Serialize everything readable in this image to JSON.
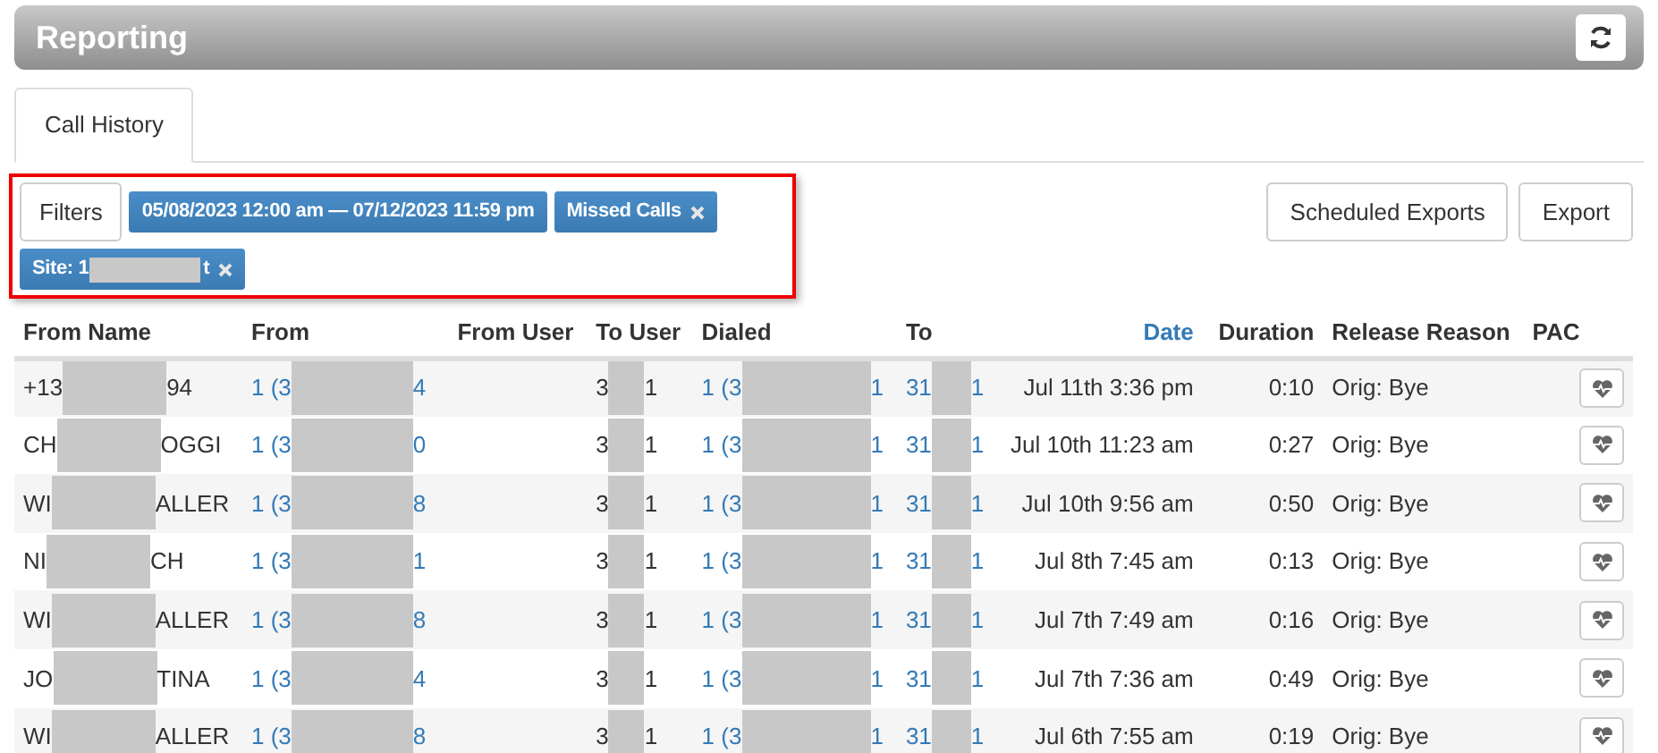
{
  "header": {
    "title": "Reporting"
  },
  "tabs": [
    {
      "label": "Call History",
      "selected": true
    }
  ],
  "filters": {
    "button": "Filters",
    "chips": [
      {
        "parts": [
          "05/08/2023 12:00 am — 07/12/2023 11:59 pm"
        ],
        "removable": false
      },
      {
        "parts": [
          "Missed Calls"
        ],
        "removable": true
      },
      {
        "parts": [
          "Site: 1",
          "t"
        ],
        "removable": true
      }
    ],
    "highlighted": true
  },
  "actions": [
    "Scheduled Exports",
    "Export"
  ],
  "table": {
    "columns": [
      {
        "label": "From Name",
        "sorted": false
      },
      {
        "label": "From",
        "sorted": false
      },
      {
        "label": "From User",
        "sorted": false
      },
      {
        "label": "To User",
        "sorted": false
      },
      {
        "label": "Dialed",
        "sorted": false
      },
      {
        "label": "To",
        "sorted": false
      },
      {
        "label": "Date",
        "sorted": true
      },
      {
        "label": "Duration",
        "sorted": false
      },
      {
        "label": "Release Reason",
        "sorted": false
      },
      {
        "label": "PAC",
        "sorted": false
      }
    ],
    "rows": [
      {
        "from_name": [
          "+13",
          "94"
        ],
        "from": [
          "1 (3",
          "4"
        ],
        "to_user": [
          "3",
          "1"
        ],
        "dialed": [
          "1 (3",
          "1"
        ],
        "to": [
          "31",
          "1"
        ],
        "date": "Jul 11th 3:36 pm",
        "duration": "0:10",
        "release_reason": "Orig: Bye"
      },
      {
        "from_name": [
          "CH",
          "OGGI"
        ],
        "from": [
          "1 (3",
          "0"
        ],
        "to_user": [
          "3",
          "1"
        ],
        "dialed": [
          "1 (3",
          "1"
        ],
        "to": [
          "31",
          "1"
        ],
        "date": "Jul 10th 11:23 am",
        "duration": "0:27",
        "release_reason": "Orig: Bye"
      },
      {
        "from_name": [
          "WI",
          "ALLER"
        ],
        "from": [
          "1 (3",
          "8"
        ],
        "to_user": [
          "3",
          "1"
        ],
        "dialed": [
          "1 (3",
          "1"
        ],
        "to": [
          "31",
          "1"
        ],
        "date": "Jul 10th 9:56 am",
        "duration": "0:50",
        "release_reason": "Orig: Bye"
      },
      {
        "from_name": [
          "NI",
          "CH"
        ],
        "from": [
          "1 (3",
          "1"
        ],
        "to_user": [
          "3",
          "1"
        ],
        "dialed": [
          "1 (3",
          "1"
        ],
        "to": [
          "31",
          "1"
        ],
        "date": "Jul 8th 7:45 am",
        "duration": "0:13",
        "release_reason": "Orig: Bye"
      },
      {
        "from_name": [
          "WI",
          "ALLER"
        ],
        "from": [
          "1 (3",
          "8"
        ],
        "to_user": [
          "3",
          "1"
        ],
        "dialed": [
          "1 (3",
          "1"
        ],
        "to": [
          "31",
          "1"
        ],
        "date": "Jul 7th 7:49 am",
        "duration": "0:16",
        "release_reason": "Orig: Bye"
      },
      {
        "from_name": [
          "JO",
          "TINA"
        ],
        "from": [
          "1 (3",
          "4"
        ],
        "to_user": [
          "3",
          "1"
        ],
        "dialed": [
          "1 (3",
          "1"
        ],
        "to": [
          "31",
          "1"
        ],
        "date": "Jul 7th 7:36 am",
        "duration": "0:49",
        "release_reason": "Orig: Bye"
      },
      {
        "from_name": [
          "WI",
          "ALLER"
        ],
        "from": [
          "1 (3",
          "8"
        ],
        "to_user": [
          "3",
          "1"
        ],
        "dialed": [
          "1 (3",
          "1"
        ],
        "to": [
          "31",
          "1"
        ],
        "date": "Jul 6th 7:55 am",
        "duration": "0:19",
        "release_reason": "Orig: Bye"
      }
    ]
  }
}
